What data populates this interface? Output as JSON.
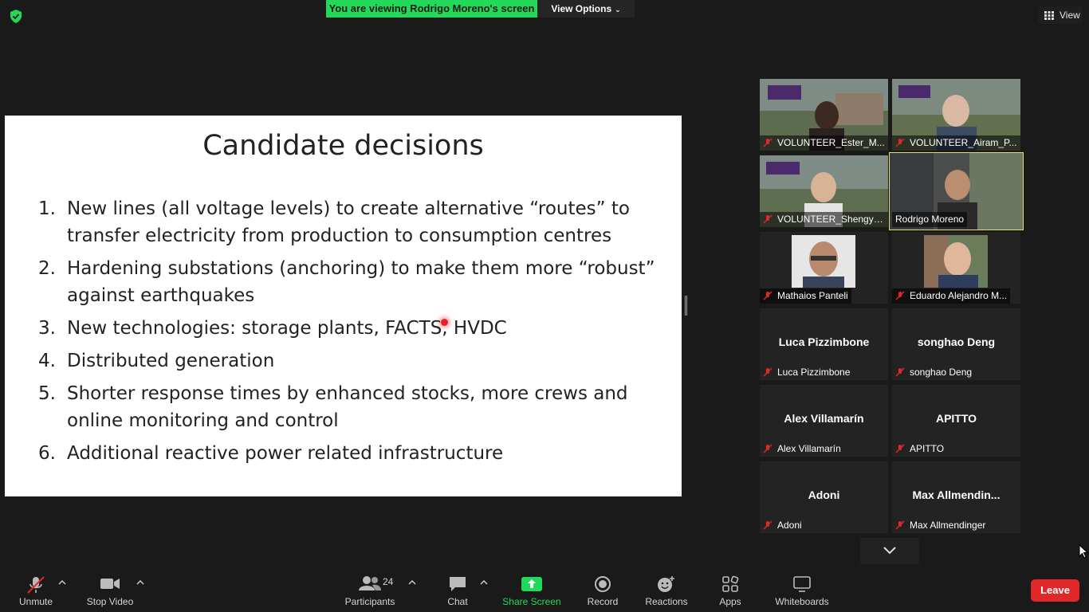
{
  "header": {
    "viewing_banner": "You are viewing Rodrigo Moreno's screen",
    "view_options": "View Options",
    "view_button": "View"
  },
  "slide": {
    "title": "Candidate decisions",
    "items": [
      {
        "num": "1.",
        "text": "New lines (all voltage levels) to create alternative “routes” to transfer electricity from production to consumption centres"
      },
      {
        "num": "2.",
        "text": "Hardening substations (anchoring) to make them more “robust” against earthquakes"
      },
      {
        "num": "3.",
        "text": "New technologies: storage plants, FACTS, HVDC"
      },
      {
        "num": "4.",
        "text": "Distributed generation"
      },
      {
        "num": "5.",
        "text": "Shorter response times by enhanced stocks, more crews and online monitoring and control"
      },
      {
        "num": "6.",
        "text": "Additional reactive power related infrastructure"
      }
    ]
  },
  "participants": [
    {
      "name": "VOLUNTEER_Ester_M...",
      "center": ""
    },
    {
      "name": "VOLUNTEER_Airam_P...",
      "center": ""
    },
    {
      "name": "VOLUNTEER_Shengye...",
      "center": ""
    },
    {
      "name": "Rodrigo Moreno",
      "center": ""
    },
    {
      "name": "Mathaios Panteli",
      "center": ""
    },
    {
      "name": "Eduardo Alejandro M...",
      "center": ""
    },
    {
      "name": "Luca Pizzimbone",
      "center": "Luca Pizzimbone"
    },
    {
      "name": "songhao Deng",
      "center": "songhao Deng"
    },
    {
      "name": "Alex Villamarín",
      "center": "Alex Villamarín"
    },
    {
      "name": "APITTO",
      "center": "APITTO"
    },
    {
      "name": "Adoni",
      "center": "Adoni"
    },
    {
      "name": "Max Allmendinger",
      "center": "Max  Allmendin..."
    }
  ],
  "toolbar": {
    "unmute": "Unmute",
    "stop_video": "Stop Video",
    "participants": "Participants",
    "participant_count": "24",
    "chat": "Chat",
    "share_screen": "Share Screen",
    "record": "Record",
    "reactions": "Reactions",
    "apps": "Apps",
    "whiteboards": "Whiteboards",
    "leave": "Leave"
  },
  "colors": {
    "banner_green": "#23d959",
    "leave_red": "#e02828",
    "mute_red": "#e02828",
    "active_speaker": "#e2de7a"
  }
}
